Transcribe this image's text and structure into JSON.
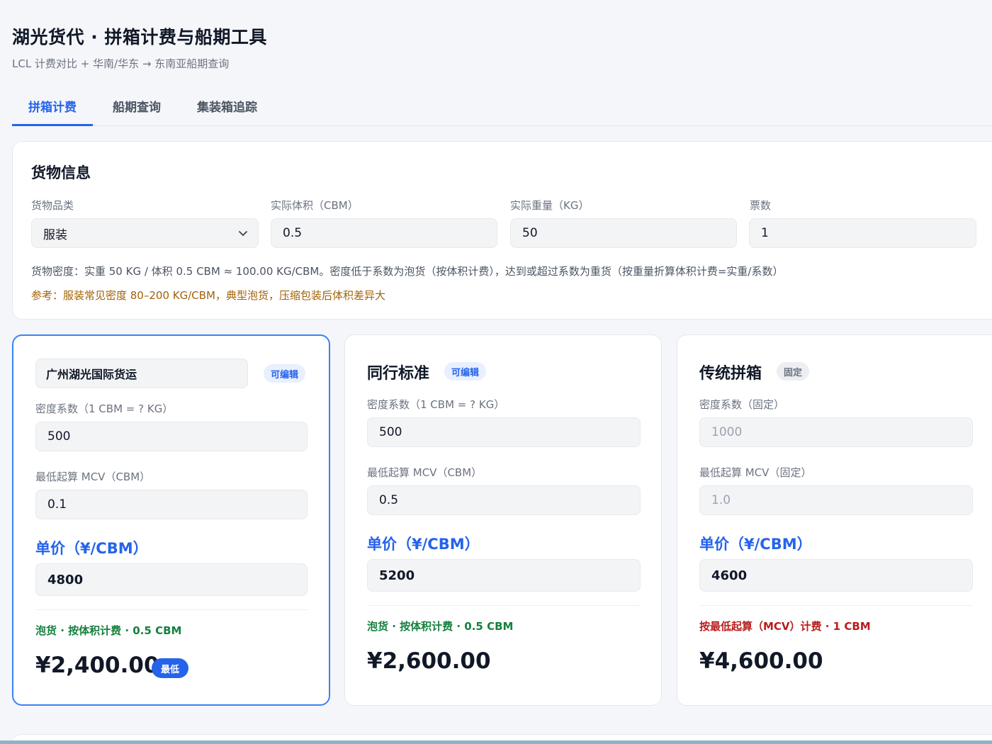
{
  "header": {
    "title": "湖光货代 · 拼箱计费与船期工具",
    "subtitle": "LCL 计费对比 + 华南/华东 → 东南亚船期查询"
  },
  "tabs": [
    {
      "label": "拼箱计费",
      "active": true
    },
    {
      "label": "船期查询",
      "active": false
    },
    {
      "label": "集装箱追踪",
      "active": false
    }
  ],
  "cargo": {
    "section_title": "货物信息",
    "category": {
      "label": "货物品类",
      "value": "服装"
    },
    "volume": {
      "label": "实际体积（CBM）",
      "value": "0.5"
    },
    "weight": {
      "label": "实际重量（KG）",
      "value": "50"
    },
    "tickets": {
      "label": "票数",
      "value": "1"
    },
    "density_hint": "货物密度：实重 50 KG / 体积 0.5 CBM ≈ 100.00 KG/CBM。密度低于系数为泡货（按体积计费），达到或超过系数为重货（按重量折算体积计费=实重/系数）",
    "reference": "参考：服装常见密度 80–200 KG/CBM，典型泡货，压缩包装后体积差异大"
  },
  "quotes": [
    {
      "name": "广州湖光国际货运",
      "badge": "可编辑",
      "density_label": "密度系数（1 CBM = ? KG）",
      "density_value": "500",
      "mcv_label": "最低起算 MCV（CBM）",
      "mcv_value": "0.1",
      "price_label": "单价（¥/CBM）",
      "price_value": "4800",
      "calc_note": "泡货 · 按体积计费 · 0.5 CBM",
      "total": "¥2,400.00",
      "best_badge": "最低"
    },
    {
      "name": "同行标准",
      "badge": "可编辑",
      "density_label": "密度系数（1 CBM = ? KG）",
      "density_value": "500",
      "mcv_label": "最低起算 MCV（CBM）",
      "mcv_value": "0.5",
      "price_label": "单价（¥/CBM）",
      "price_value": "5200",
      "calc_note": "泡货 · 按体积计费 · 0.5 CBM",
      "total": "¥2,600.00"
    },
    {
      "name": "传统拼箱",
      "badge": "固定",
      "density_label": "密度系数（固定）",
      "density_value": "1000",
      "mcv_label": "最低起算 MCV（固定）",
      "mcv_value": "1.0",
      "price_label": "单价（¥/CBM）",
      "price_value": "4600",
      "calc_note": "按最低起算（MCV）计费 · 1 CBM",
      "total": "¥4,600.00"
    }
  ],
  "colors": {
    "accent": "#2563eb",
    "green": "#15803d",
    "red": "#b91c1c",
    "reference": "#a16207"
  }
}
